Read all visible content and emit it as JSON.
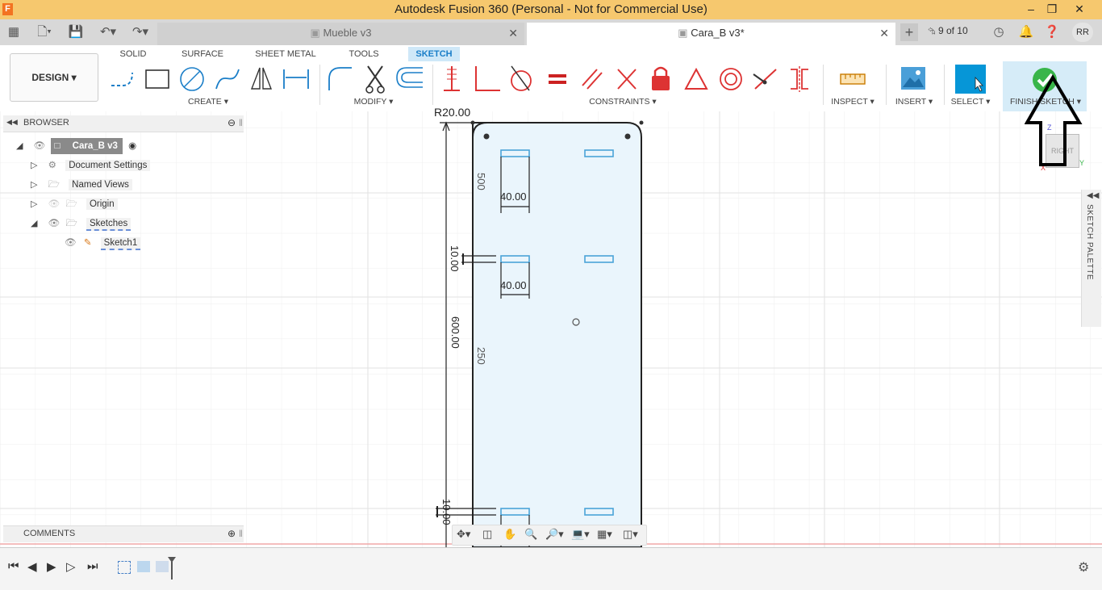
{
  "app": {
    "title": "Autodesk Fusion 360 (Personal - Not for Commercial Use)"
  },
  "tabs": [
    {
      "label": "Mueble v3",
      "active": false
    },
    {
      "label": "Cara_B v3*",
      "active": true
    }
  ],
  "header_right": {
    "version": "9 of 10",
    "user": "RR"
  },
  "workspace": "DESIGN ▾",
  "ribbon_tabs": [
    "SOLID",
    "SURFACE",
    "SHEET METAL",
    "TOOLS",
    "SKETCH"
  ],
  "groups": {
    "create": "CREATE ▾",
    "modify": "MODIFY ▾",
    "constraints": "CONSTRAINTS ▾",
    "inspect": "INSPECT ▾",
    "insert": "INSERT ▾",
    "select": "SELECT ▾",
    "finish": "FINISH SKETCH ▾"
  },
  "browser": {
    "title": "BROWSER",
    "root": "Cara_B v3",
    "items": [
      "Document Settings",
      "Named Views",
      "Origin",
      "Sketches",
      "Sketch1"
    ]
  },
  "comments": "COMMENTS",
  "palette": "SKETCH PALETTE",
  "sketch": {
    "radius": "R20.00",
    "dims": [
      "500",
      "40.00",
      "10.00",
      "40.00",
      "600.00",
      "250",
      "10.00"
    ]
  },
  "viewcube": {
    "face": "RIGHT",
    "z": "Z",
    "y": "Y",
    "x": "X"
  },
  "colors": {
    "titlebar": "#f6c86e",
    "accent": "#0696d7",
    "sketch_fill": "#eaf5fc",
    "finish_check": "#39b54a"
  }
}
